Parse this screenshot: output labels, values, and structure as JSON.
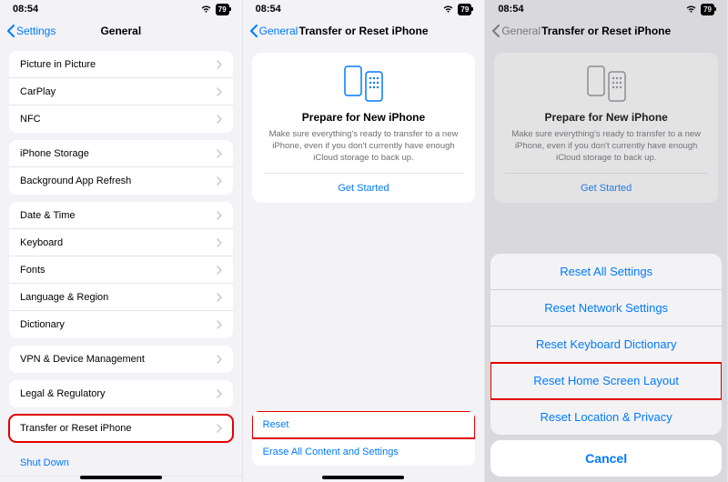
{
  "status": {
    "time": "08:54",
    "battery": "79"
  },
  "screen1": {
    "back": "Settings",
    "title": "General",
    "groups": [
      [
        "Picture in Picture",
        "CarPlay",
        "NFC"
      ],
      [
        "iPhone Storage",
        "Background App Refresh"
      ],
      [
        "Date & Time",
        "Keyboard",
        "Fonts",
        "Language & Region",
        "Dictionary"
      ],
      [
        "VPN & Device Management"
      ],
      [
        "Legal & Regulatory"
      ],
      [
        "Transfer or Reset iPhone"
      ]
    ],
    "shutdown": "Shut Down"
  },
  "screen2": {
    "back": "General",
    "title": "Transfer or Reset iPhone",
    "card": {
      "heading": "Prepare for New iPhone",
      "body": "Make sure everything's ready to transfer to a new iPhone, even if you don't currently have enough iCloud storage to back up.",
      "cta": "Get Started"
    },
    "reset": "Reset",
    "erase": "Erase All Content and Settings"
  },
  "screen3": {
    "back": "General",
    "title": "Transfer or Reset iPhone",
    "card": {
      "heading": "Prepare for New iPhone",
      "body": "Make sure everything's ready to transfer to a new iPhone, even if you don't currently have enough iCloud storage to back up.",
      "cta": "Get Started"
    },
    "sheet": {
      "options": [
        "Reset All Settings",
        "Reset Network Settings",
        "Reset Keyboard Dictionary",
        "Reset Home Screen Layout",
        "Reset Location & Privacy"
      ],
      "cancel": "Cancel"
    }
  }
}
